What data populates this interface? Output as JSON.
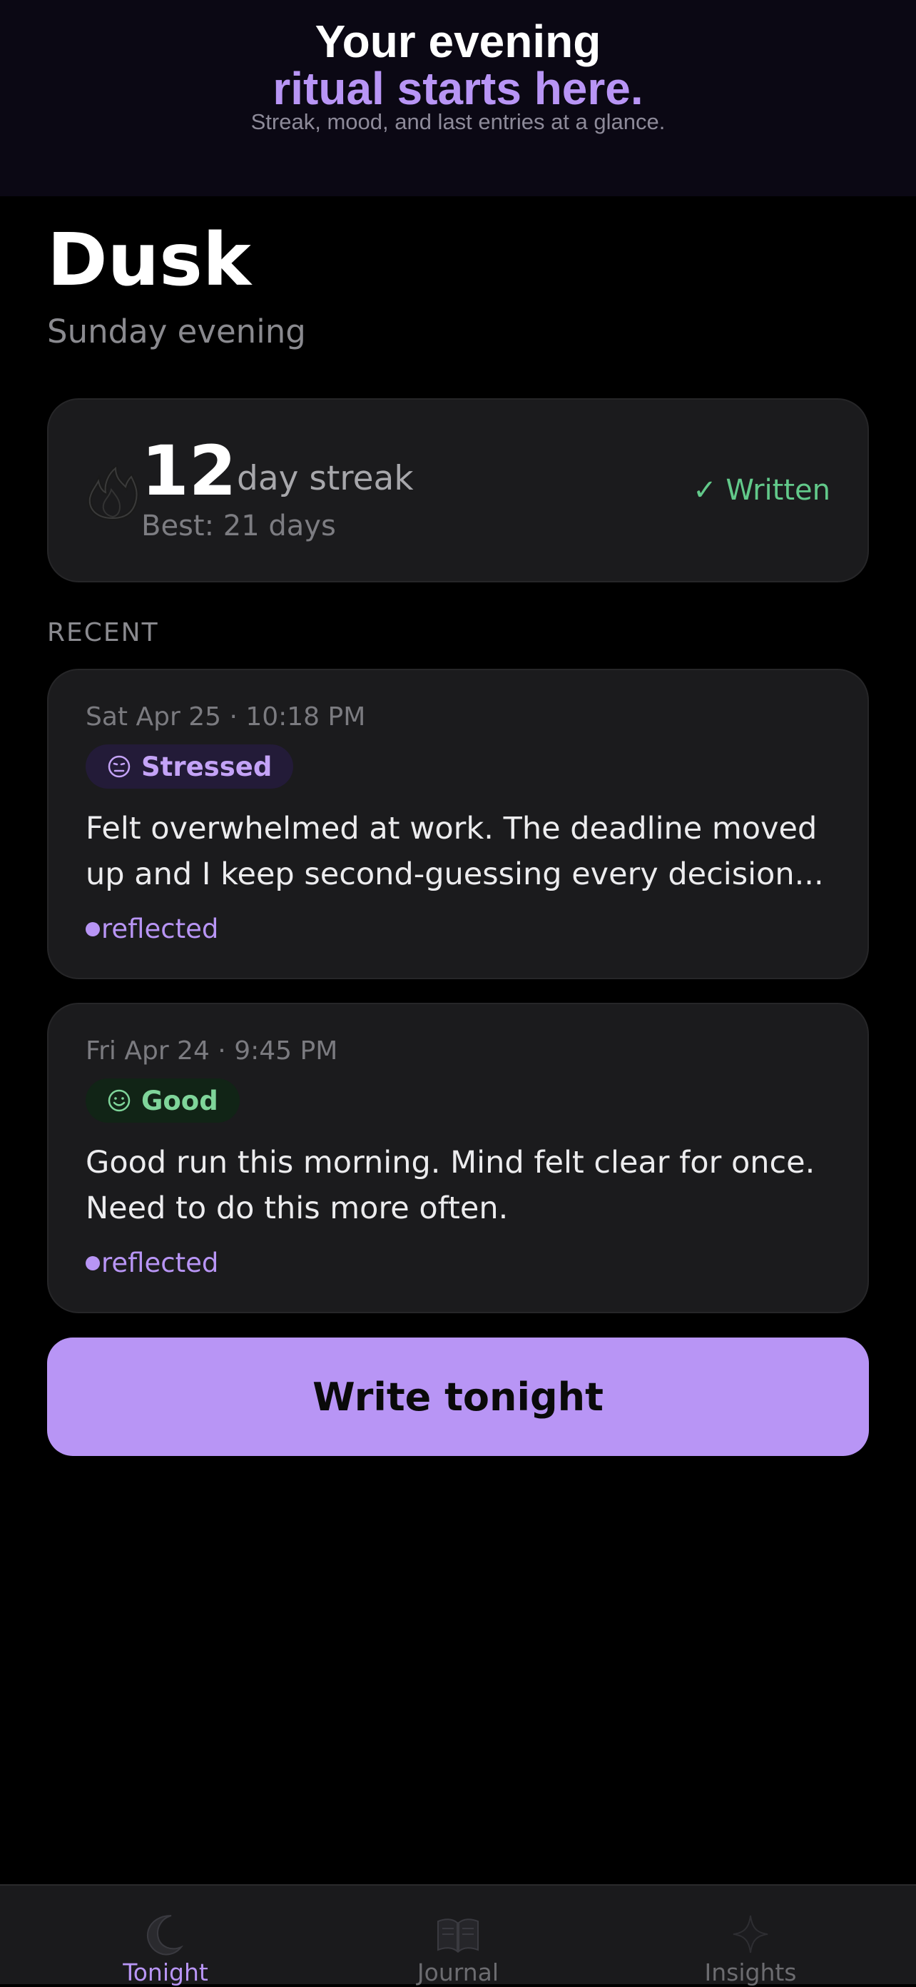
{
  "promo": {
    "line1": "Your evening",
    "line2": "ritual starts here.",
    "line3": "Streak, mood, and last entries at a glance."
  },
  "header": {
    "title": "Dusk",
    "subtitle": "Sunday evening"
  },
  "streak": {
    "icon": "flame-icon",
    "count": "12",
    "label": "day streak",
    "best": "Best: 21 days",
    "status": "✓ Written"
  },
  "recent": {
    "label": "RECENT",
    "entries": [
      {
        "date": "Sat Apr 25 · 10:18 PM",
        "mood": "Stressed",
        "mood_icon": "stressed-face-icon",
        "text": "Felt overwhelmed at work. The deadline moved up and I keep second-guessing every decision...",
        "tag": "reflected"
      },
      {
        "date": "Fri Apr 24 · 9:45 PM",
        "mood": "Good",
        "mood_icon": "smile-face-icon",
        "text": "Good run this morning. Mind felt clear for once. Need to do this more often.",
        "tag": "reflected"
      }
    ]
  },
  "cta": {
    "label": "Write tonight"
  },
  "tabs": [
    {
      "label": "Tonight",
      "icon": "moon-icon",
      "active": true
    },
    {
      "label": "Journal",
      "icon": "book-icon",
      "active": false
    },
    {
      "label": "Insights",
      "icon": "sparkle-icon",
      "active": false
    }
  ],
  "colors": {
    "accent": "#b895f5",
    "success": "#62c98a",
    "background": "#000000",
    "card": "#1b1b1d"
  }
}
